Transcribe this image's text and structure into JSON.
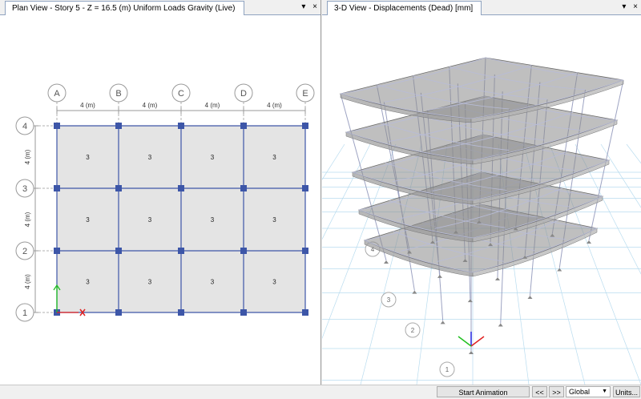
{
  "left_pane": {
    "tab_title": "Plan View - Story 5 - Z = 16.5 (m)  Uniform Loads Gravity  (Live)",
    "dropdown_glyph": "▾",
    "close_glyph": "×",
    "grid_x_labels": [
      "A",
      "B",
      "C",
      "D",
      "E"
    ],
    "grid_y_labels": [
      "1",
      "2",
      "3",
      "4"
    ],
    "dim_x_labels": [
      "4 (m)",
      "4 (m)",
      "4 (m)",
      "4 (m)"
    ],
    "dim_y_labels": [
      "4 (m)",
      "4 (m)",
      "4 (m)"
    ],
    "slab_load_value": "3"
  },
  "right_pane": {
    "tab_title": "3-D View  - Displacements (Dead)  [mm]",
    "dropdown_glyph": "▾",
    "close_glyph": "×",
    "grid_bubble_labels": [
      "1",
      "2",
      "3",
      "4"
    ]
  },
  "statusbar": {
    "start_animation": "Start Animation",
    "prev": "<<",
    "next": ">>",
    "coord_system": "Global",
    "units": "Units..."
  },
  "colors": {
    "grid_line": "#3d56a8",
    "joint": "#3d56a8",
    "slab_fill": "#e4e4e4",
    "axis_x": "#e02020",
    "axis_y": "#20c020",
    "axis_z": "#2020e0"
  }
}
